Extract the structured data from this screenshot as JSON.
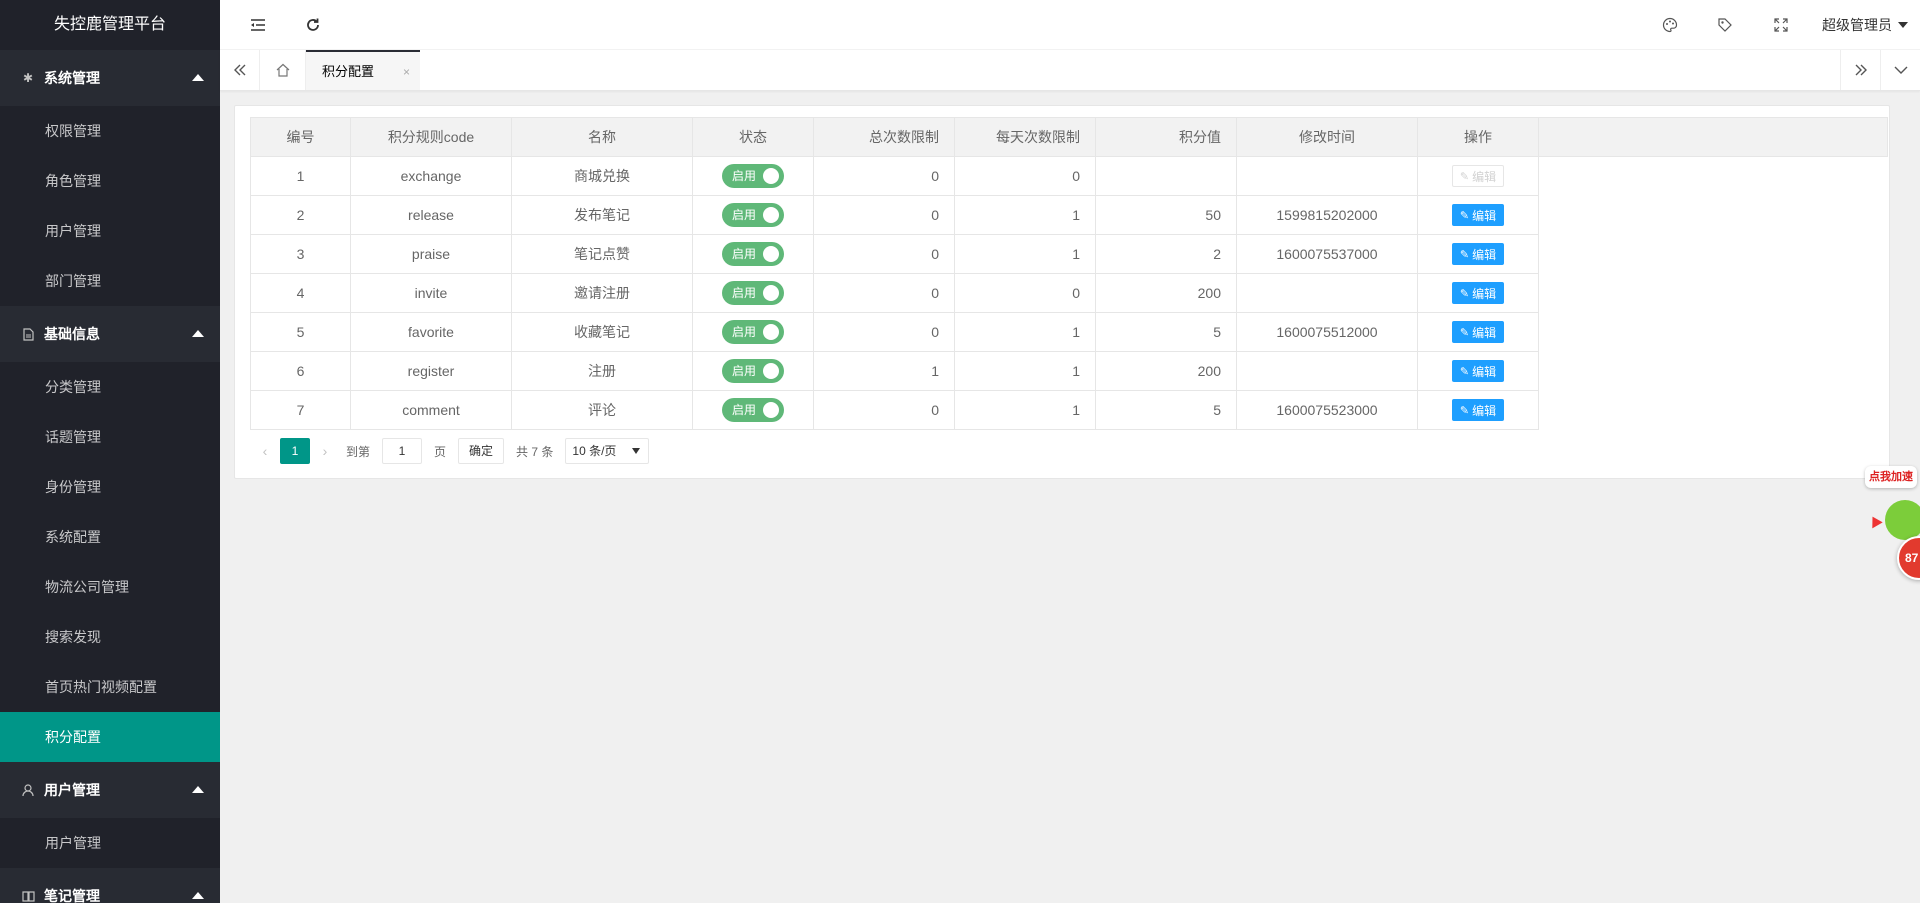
{
  "app": {
    "title": "失控鹿管理平台"
  },
  "sidebar": {
    "groups": [
      {
        "label": "系统管理",
        "icon": "gear-icon",
        "items": [
          "权限管理",
          "角色管理",
          "用户管理",
          "部门管理"
        ]
      },
      {
        "label": "基础信息",
        "icon": "document-icon",
        "items": [
          "分类管理",
          "话题管理",
          "身份管理",
          "系统配置",
          "物流公司管理",
          "搜索发现",
          "首页热门视频配置",
          "积分配置"
        ]
      },
      {
        "label": "用户管理",
        "icon": "user-icon",
        "items": [
          "用户管理"
        ]
      },
      {
        "label": "笔记管理",
        "icon": "book-icon",
        "items": []
      }
    ],
    "active_item": "积分配置"
  },
  "header": {
    "user": "超级管理员",
    "icons": [
      "menu-toggle-icon",
      "refresh-icon",
      "theme-palette-icon",
      "tag-icon",
      "fullscreen-icon"
    ]
  },
  "tabs": {
    "items": [
      {
        "label": "积分配置",
        "close": "×"
      }
    ]
  },
  "table": {
    "columns": [
      "编号",
      "积分规则code",
      "名称",
      "状态",
      "总次数限制",
      "每天次数限制",
      "积分值",
      "修改时间",
      "操作"
    ],
    "rows": [
      {
        "id": "1",
        "code": "exchange",
        "name": "商城兑换",
        "status": "启用",
        "total": "0",
        "daily": "0",
        "points": "",
        "modified": "",
        "action": "编辑",
        "action_disabled": true
      },
      {
        "id": "2",
        "code": "release",
        "name": "发布笔记",
        "status": "启用",
        "total": "0",
        "daily": "1",
        "points": "50",
        "modified": "1599815202000",
        "action": "编辑",
        "action_disabled": false
      },
      {
        "id": "3",
        "code": "praise",
        "name": "笔记点赞",
        "status": "启用",
        "total": "0",
        "daily": "1",
        "points": "2",
        "modified": "1600075537000",
        "action": "编辑",
        "action_disabled": false
      },
      {
        "id": "4",
        "code": "invite",
        "name": "邀请注册",
        "status": "启用",
        "total": "0",
        "daily": "0",
        "points": "200",
        "modified": "",
        "action": "编辑",
        "action_disabled": false
      },
      {
        "id": "5",
        "code": "favorite",
        "name": "收藏笔记",
        "status": "启用",
        "total": "0",
        "daily": "1",
        "points": "5",
        "modified": "1600075512000",
        "action": "编辑",
        "action_disabled": false
      },
      {
        "id": "6",
        "code": "register",
        "name": "注册",
        "status": "启用",
        "total": "1",
        "daily": "1",
        "points": "200",
        "modified": "",
        "action": "编辑",
        "action_disabled": false
      },
      {
        "id": "7",
        "code": "comment",
        "name": "评论",
        "status": "启用",
        "total": "0",
        "daily": "1",
        "points": "5",
        "modified": "1600075523000",
        "action": "编辑",
        "action_disabled": false
      }
    ]
  },
  "pager": {
    "current": "1",
    "goto_label": "到第",
    "goto_value": "1",
    "page_unit": "页",
    "confirm": "确定",
    "total": "共 7 条",
    "limit": "10 条/页"
  },
  "float_widget": {
    "bubble": "点我加速",
    "number": "87"
  },
  "colors": {
    "sidebar": "#20222a",
    "active": "#009688",
    "switch_on": "#5fb878",
    "edit_btn": "#1e9fff"
  }
}
